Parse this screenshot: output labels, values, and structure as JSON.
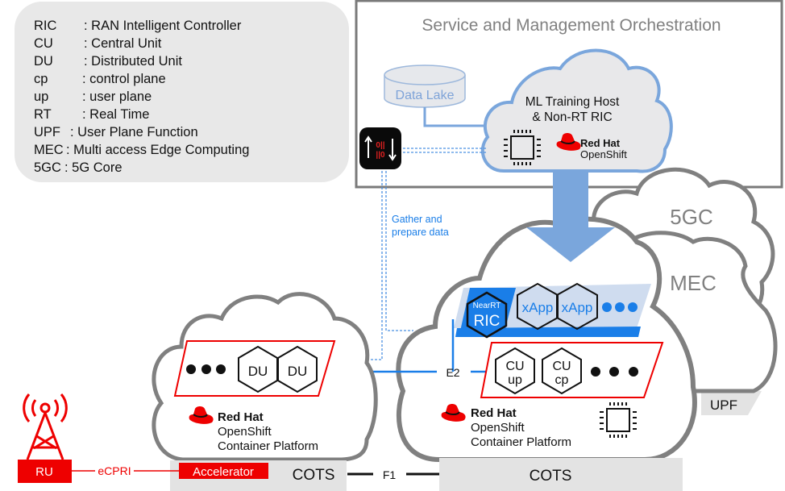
{
  "legend": {
    "items": [
      {
        "abbr": "RIC",
        "desc": ": RAN Intelligent Controller"
      },
      {
        "abbr": "CU",
        "desc": ": Central Unit"
      },
      {
        "abbr": "DU",
        "desc": ": Distributed Unit"
      },
      {
        "abbr": "cp",
        "desc": ": control plane"
      },
      {
        "abbr": "up",
        "desc": ": user plane"
      },
      {
        "abbr": "RT",
        "desc": ": Real Time"
      },
      {
        "abbr": "UPF",
        "desc": ": User Plane Function"
      },
      {
        "abbr": "MEC",
        "desc": ": Multi access Edge Computing"
      },
      {
        "abbr": "5GC",
        "desc": ": 5G Core"
      }
    ]
  },
  "smo": {
    "title": "Service and Management Orchestration",
    "data_lake": "Data Lake",
    "ml_host_line1": "ML Training Host",
    "ml_host_line2": "& Non-RT RIC",
    "redhat": "Red Hat",
    "openshift": "OpenShift"
  },
  "gather": {
    "line1": "Gather and",
    "line2": "prepare data",
    "icon": "data-transfer-icon"
  },
  "clouds": {
    "core_5gc": "5GC",
    "mec": "MEC",
    "upf": "UPF"
  },
  "central": {
    "near_rt": "NearRT",
    "ric": "RIC",
    "xapp1": "xApp",
    "xapp2": "xApp",
    "e2": "E2",
    "cu_up_1": "CU",
    "cu_up_2": "up",
    "cu_cp_1": "CU",
    "cu_cp_2": "cp",
    "redhat": "Red Hat",
    "openshift": "OpenShift",
    "platform": "Container Platform",
    "cots": "COTS"
  },
  "edge": {
    "du1": "DU",
    "du2": "DU",
    "redhat": "Red Hat",
    "openshift": "OpenShift",
    "platform": "Container Platform",
    "accelerator": "Accelerator",
    "cots": "COTS"
  },
  "links": {
    "f1": "F1",
    "ecpri": "eCPRI",
    "ru": "RU"
  },
  "colors": {
    "redhat_red": "#ee0000",
    "cloud_gray": "#808080",
    "smo_blue": "#7aa6dc",
    "link_blue": "#1a7ee8",
    "cots_gray": "#e3e3e3"
  }
}
